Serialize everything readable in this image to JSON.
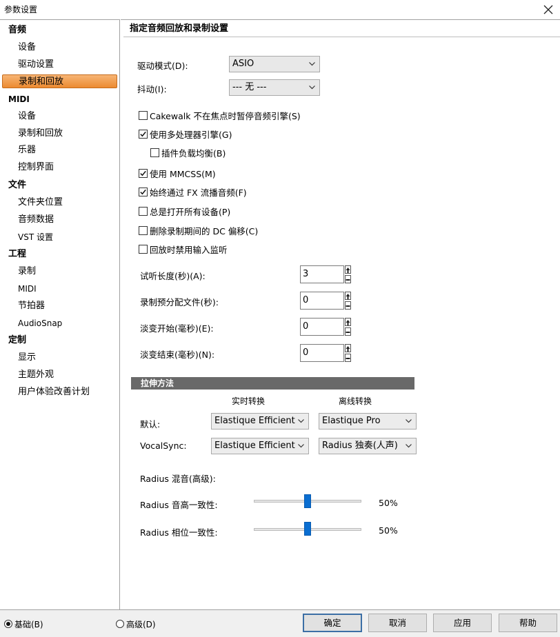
{
  "window": {
    "title": "参数设置"
  },
  "sidebar": {
    "items": [
      {
        "label": "音频",
        "kind": "group"
      },
      {
        "label": "设备",
        "kind": "child"
      },
      {
        "label": "驱动设置",
        "kind": "child"
      },
      {
        "label": "录制和回放",
        "kind": "child",
        "selected": true
      },
      {
        "label": "MIDI",
        "kind": "group"
      },
      {
        "label": "设备",
        "kind": "child"
      },
      {
        "label": "录制和回放",
        "kind": "child"
      },
      {
        "label": "乐器",
        "kind": "child"
      },
      {
        "label": "控制界面",
        "kind": "child"
      },
      {
        "label": "文件",
        "kind": "group"
      },
      {
        "label": "文件夹位置",
        "kind": "child"
      },
      {
        "label": "音频数据",
        "kind": "child"
      },
      {
        "label": "VST 设置",
        "kind": "child"
      },
      {
        "label": "工程",
        "kind": "group"
      },
      {
        "label": "录制",
        "kind": "child"
      },
      {
        "label": "MIDI",
        "kind": "child"
      },
      {
        "label": "节拍器",
        "kind": "child"
      },
      {
        "label": "AudioSnap",
        "kind": "child"
      },
      {
        "label": "定制",
        "kind": "group"
      },
      {
        "label": "显示",
        "kind": "child"
      },
      {
        "label": "主题外观",
        "kind": "child"
      },
      {
        "label": "用户体验改善计划",
        "kind": "child"
      }
    ]
  },
  "main": {
    "header": "指定音频回放和录制设置",
    "driver_mode": {
      "label": "驱动模式(D):",
      "value": "ASIO"
    },
    "dither": {
      "label": "抖动(I):",
      "value": "--- 无 ---"
    },
    "checkboxes": [
      {
        "label": "Cakewalk 不在焦点时暂停音频引擎(S)",
        "checked": false
      },
      {
        "label": "使用多处理器引擎(G)",
        "checked": true
      },
      {
        "label": "插件负载均衡(B)",
        "checked": false
      },
      {
        "label": "使用 MMCSS(M)",
        "checked": true
      },
      {
        "label": "始终通过 FX 流播音频(F)",
        "checked": true
      },
      {
        "label": "总是打开所有设备(P)",
        "checked": false
      },
      {
        "label": "删除录制期间的 DC 偏移(C)",
        "checked": false
      },
      {
        "label": "回放时禁用输入监听",
        "checked": false
      }
    ],
    "numeric_fields": [
      {
        "label": "试听长度(秒)(A):",
        "value": "3"
      },
      {
        "label": "录制预分配文件(秒):",
        "value": "0"
      },
      {
        "label": "淡变开始(毫秒)(E):",
        "value": "0"
      },
      {
        "label": "淡变结束(毫秒)(N):",
        "value": "0"
      }
    ],
    "stretch": {
      "section_title": "拉伸方法",
      "col_realtime": "实时转换",
      "col_offline": "离线转换",
      "rows": [
        {
          "label": "默认:",
          "realtime": "Elastique Efficient",
          "offline": "Elastique Pro"
        },
        {
          "label": "VocalSync:",
          "realtime": "Elastique Efficient",
          "offline": "Radius 独奏(人声)"
        }
      ],
      "radius_mix_label": "Radius 混音(高级):",
      "sliders": [
        {
          "label": "Radius 音高一致性:",
          "value_text": "50%",
          "value": 0.5
        },
        {
          "label": "Radius 相位一致性:",
          "value_text": "50%",
          "value": 0.5
        }
      ]
    }
  },
  "footer": {
    "basic_label": "基础(B)",
    "advanced_label": "高级(D)",
    "ok": "确定",
    "cancel": "取消",
    "apply": "应用",
    "help": "帮助"
  },
  "colors": {
    "selection": "#ec8a30",
    "section_bar": "#696969",
    "slider_thumb": "#0a6ed1"
  }
}
